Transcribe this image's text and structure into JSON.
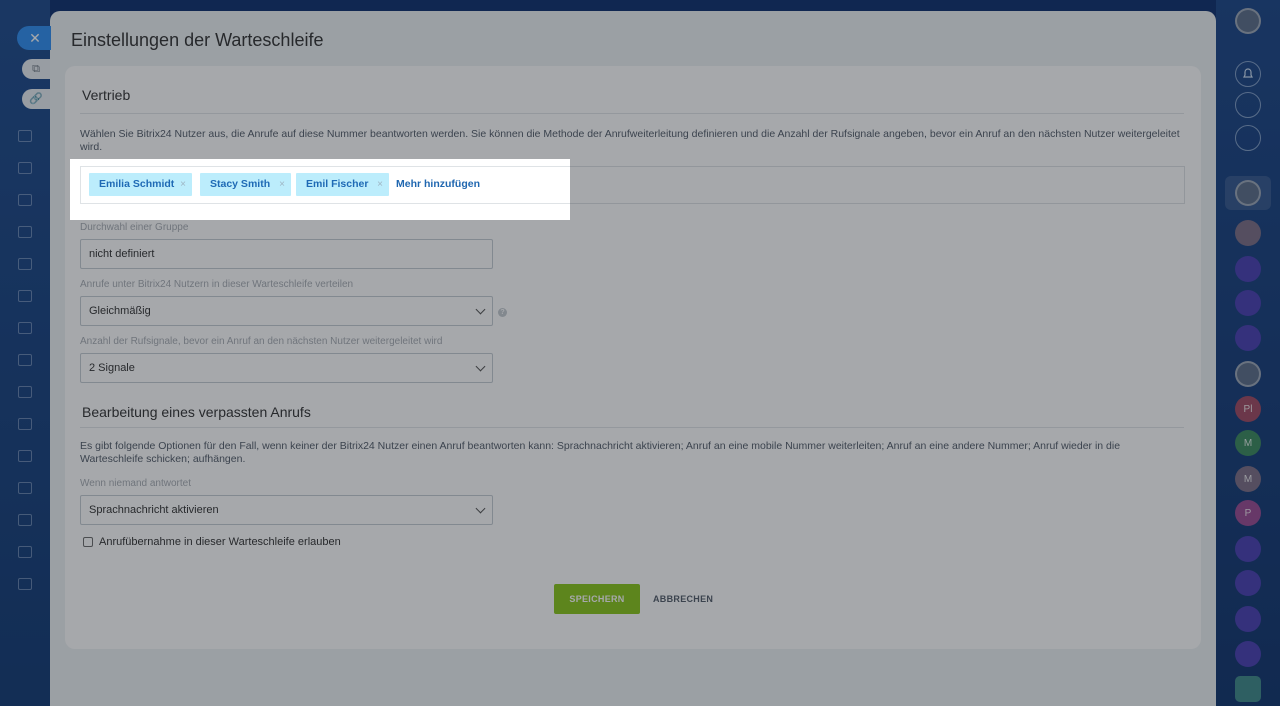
{
  "slider": {
    "title": "Einstellungen der Warteschleife"
  },
  "group": {
    "title": "Vertrieb",
    "description": "Wählen Sie Bitrix24 Nutzer aus, die Anrufe auf diese Nummer beantworten werden. Sie können die Methode der Anrufweiterleitung definieren und die Anzahl der Rufsignale angeben, bevor ein Anruf an den nächsten Nutzer weitergeleitet wird.",
    "users": [
      "Emilia Schmidt",
      "Stacy Smith",
      "Emil Fischer"
    ],
    "add_more": "Mehr hinzufügen",
    "remove_glyph": "×"
  },
  "fields": {
    "extension_label": "Durchwahl einer Gruppe",
    "extension_value": "nicht definiert",
    "distribution_label": "Anrufe unter Bitrix24 Nutzern in dieser Warteschleife verteilen",
    "distribution_value": "Gleichmäßig",
    "rings_label": "Anzahl der Rufsignale, bevor ein Anruf an den nächsten Nutzer weitergeleitet wird",
    "rings_value": "2 Signale",
    "help": "?"
  },
  "missed": {
    "title": "Bearbeitung eines verpassten Anrufs",
    "description": "Es gibt folgende Optionen für den Fall, wenn keiner der Bitrix24 Nutzer einen Anruf beantworten kann: Sprachnachricht aktivieren; Anruf an eine mobile Nummer weiterleiten; Anruf an eine andere Nummer; Anruf wieder in die Warteschleife schicken; aufhängen.",
    "no_answer_label": "Wenn niemand antwortet",
    "no_answer_value": "Sprachnachricht aktivieren",
    "allow_pickup_label": "Anrufübernahme in dieser Warteschleife erlauben",
    "allow_pickup_checked": false
  },
  "buttons": {
    "save": "SPEICHERN",
    "cancel": "ABBRECHEN"
  },
  "right_rail": {
    "avatars": [
      "Pl",
      "M",
      "M",
      "P"
    ]
  },
  "icons": [
    "close-icon",
    "open-external-icon",
    "link-icon",
    "bell-icon",
    "help-icon",
    "chevron-down-icon"
  ]
}
